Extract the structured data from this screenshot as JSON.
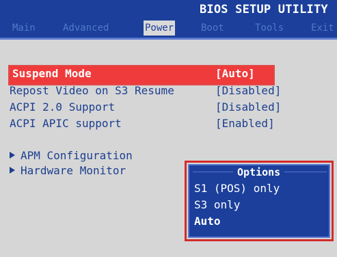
{
  "header": {
    "title": "BIOS SETUP UTILITY",
    "tabs": [
      "Main",
      "Advanced",
      "Power",
      "Boot",
      "Tools",
      "Exit"
    ],
    "active_tab": "Power"
  },
  "items": [
    {
      "label": "Suspend Mode",
      "value": "[Auto]",
      "selected": true
    },
    {
      "label": "Repost Video on S3 Resume",
      "value": "[Disabled]"
    },
    {
      "label": "ACPI 2.0 Support",
      "value": "[Disabled]"
    },
    {
      "label": "ACPI APIC support",
      "value": "[Enabled]"
    }
  ],
  "submenus": [
    "APM Configuration",
    "Hardware Monitor"
  ],
  "options_popup": {
    "title": "Options",
    "options": [
      "S1 (POS) only",
      "S3 only",
      "Auto"
    ],
    "selected": "Auto"
  },
  "colors": {
    "header_bg": "#1b3f9a",
    "content_bg": "#d6d6d6",
    "highlight": "#ef3b3b",
    "text": "#1c3f8f"
  }
}
